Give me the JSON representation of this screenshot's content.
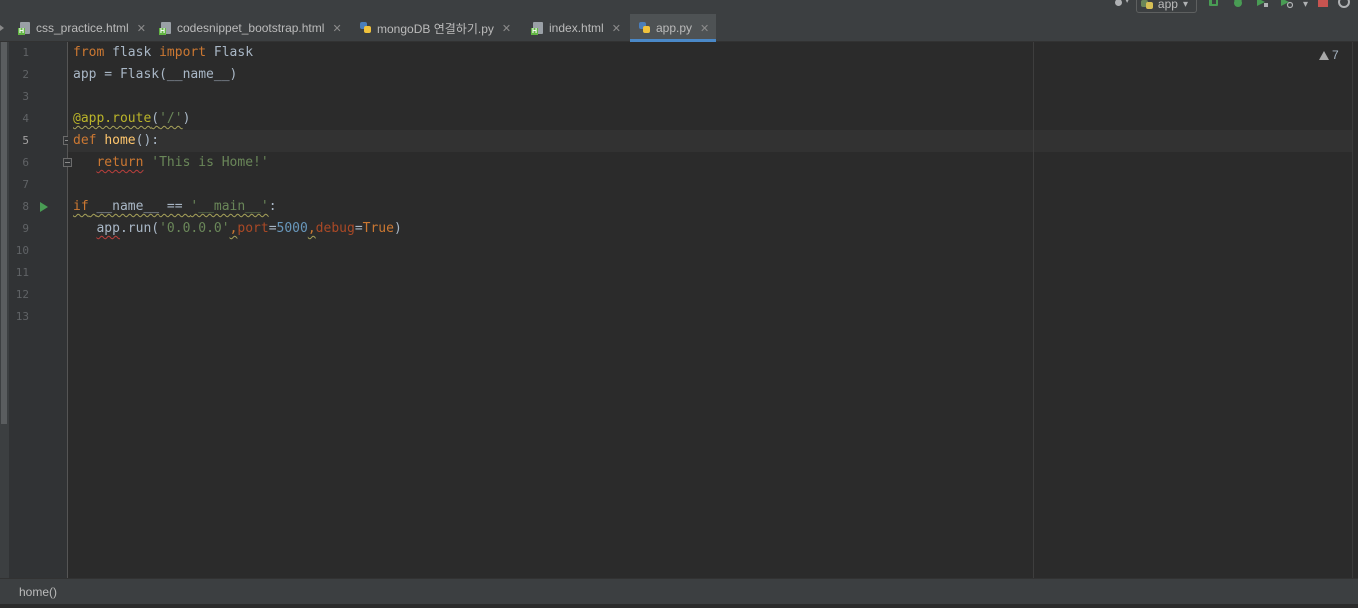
{
  "toolbar": {
    "run_config": "app"
  },
  "tabs": [
    {
      "label": "css_practice.html",
      "type": "html",
      "active": false
    },
    {
      "label": "codesnippet_bootstrap.html",
      "type": "html",
      "active": false
    },
    {
      "label": "mongoDB 연결하기.py",
      "type": "py",
      "active": false
    },
    {
      "label": "index.html",
      "type": "html",
      "active": false
    },
    {
      "label": "app.py",
      "type": "py",
      "active": true
    }
  ],
  "editor": {
    "current_line": 5,
    "line_numbers": [
      "1",
      "2",
      "3",
      "4",
      "5",
      "6",
      "7",
      "8",
      "9",
      "10",
      "11",
      "12",
      "13"
    ],
    "inspection_count": "7",
    "code": {
      "l1": {
        "kw1": "from",
        "t1": " flask ",
        "kw2": "import",
        "t2": " Flask"
      },
      "l2": {
        "text": "app = Flask(__name__)"
      },
      "l4": {
        "dec": "@app.route",
        "t1": "(",
        "str": "'/'",
        "t2": ")"
      },
      "l5": {
        "kw": "def",
        "sp": " ",
        "fn": "home",
        "t1": "():"
      },
      "l6": {
        "indent": "   ",
        "kw": "return",
        "sp": " ",
        "str": "'This is Home!'"
      },
      "l8": {
        "kw": "if",
        "sp": " ",
        "name": "__name__",
        "eq": " == ",
        "str": "'__main__'",
        "t1": ":"
      },
      "l9": {
        "indent": "   ",
        "app": "app",
        "t1": ".run(",
        "str": "'0.0.0.0'",
        "c1": ",",
        "p1": "port",
        "e1": "=",
        "num": "5000",
        "c2": ",",
        "p2": "debug",
        "e2": "=",
        "kw": "True",
        "t2": ")"
      }
    }
  },
  "breadcrumb": {
    "text": "home()"
  },
  "colors": {
    "keyword": "#cc7832",
    "string": "#6a8759",
    "number": "#6897bb",
    "decorator": "#bbb529",
    "function": "#ffc66d",
    "param": "#aa4926",
    "text": "#a9b7c6",
    "accent": "#4a88c7",
    "run": "#499c54"
  },
  "icons": [
    "user-icon",
    "run-config-icon",
    "build-icon",
    "debug-icon",
    "coverage-icon",
    "profile-icon",
    "stop-icon",
    "search-icon",
    "html-file-icon",
    "python-file-icon",
    "close-icon",
    "warning-icon",
    "run-gutter-icon",
    "fold-icon"
  ]
}
